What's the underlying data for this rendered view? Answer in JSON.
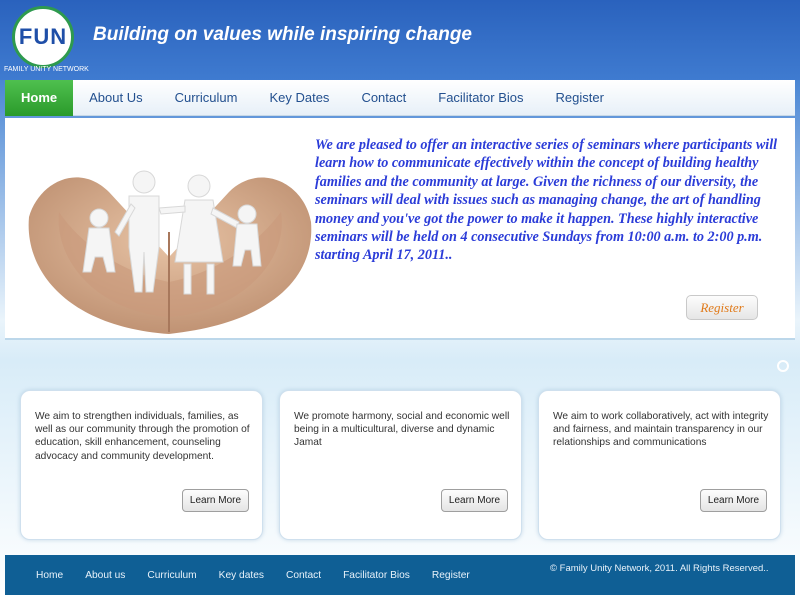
{
  "header": {
    "logo_text": "FUN",
    "logo_subtitle": "FAMILY UNITY NETWORK",
    "tagline": "Building on values while inspiring change"
  },
  "nav": {
    "items": [
      "Home",
      "About Us",
      "Curriculum",
      "Key Dates",
      "Contact",
      "Facilitator Bios",
      "Register"
    ],
    "active": "Home"
  },
  "hero": {
    "image_icon": "hands-holding-paper-family-icon",
    "text": "We are pleased to offer an interactive series of seminars where participants will learn how to communicate effectively within the concept of building healthy families and the community at large. Given the richness of our diversity, the seminars will deal with issues such as managing change, the art of handling money and you've got the power to make it happen. These highly interactive seminars will be held on 4 consecutive Sundays from 10:00 a.m. to 2:00 p.m. starting April 17, 2011..",
    "register_label": "Register"
  },
  "cards": [
    {
      "text": "We aim to strengthen individuals, families, as well as our community through the promotion of education, skill enhancement, counseling advocacy and community development.",
      "button": "Learn More"
    },
    {
      "text": "We promote harmony, social and economic well being in a multicultural, diverse and dynamic Jamat",
      "button": "Learn More"
    },
    {
      "text": "We aim to work collaboratively, act with integrity and fairness, and maintain transparency in our relationships and communications",
      "button": "Learn More"
    }
  ],
  "footer": {
    "links": [
      "Home",
      "About us",
      "Curriculum",
      "Key dates",
      "Contact",
      "Facilitator Bios",
      "Register"
    ],
    "copyright": "© Family Unity Network, 2011. All Rights Reserved.."
  },
  "colors": {
    "header_blue": "#2f6bc4",
    "nav_active_green": "#3aab3a",
    "nav_text": "#23508f",
    "hero_text_blue": "#2b3cd8",
    "register_orange": "#e07a1a",
    "footer_blue": "#0f5f95"
  }
}
